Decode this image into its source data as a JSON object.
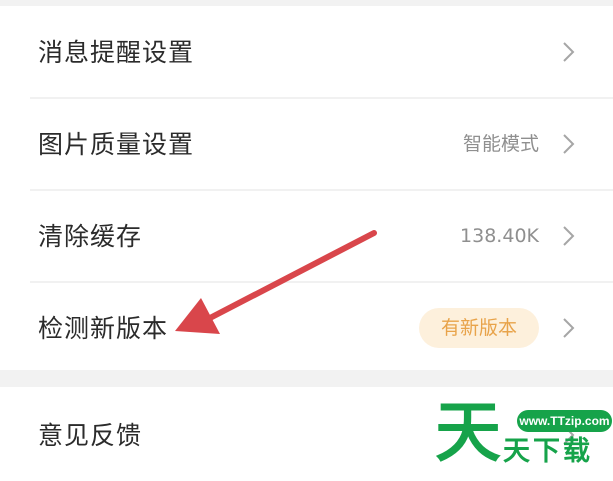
{
  "settings": {
    "items": [
      {
        "label": "消息提醒设置",
        "value": "",
        "badge": ""
      },
      {
        "label": "图片质量设置",
        "value": "智能模式",
        "badge": ""
      },
      {
        "label": "清除缓存",
        "value": "138.40K",
        "badge": ""
      },
      {
        "label": "检测新版本",
        "value": "",
        "badge": "有新版本"
      }
    ],
    "secondary": [
      {
        "label": "意见反馈"
      }
    ]
  },
  "watermark": {
    "url": "www.TTzip.com",
    "big_char": "天",
    "small_text": "天下载"
  },
  "colors": {
    "badge_bg": "#fdf0dc",
    "badge_text": "#e8a34a",
    "arrow": "#d9464b",
    "watermark": "#16a34a"
  },
  "icons": {
    "chevron": "chevron-right-icon",
    "annotation": "red-arrow-icon"
  }
}
